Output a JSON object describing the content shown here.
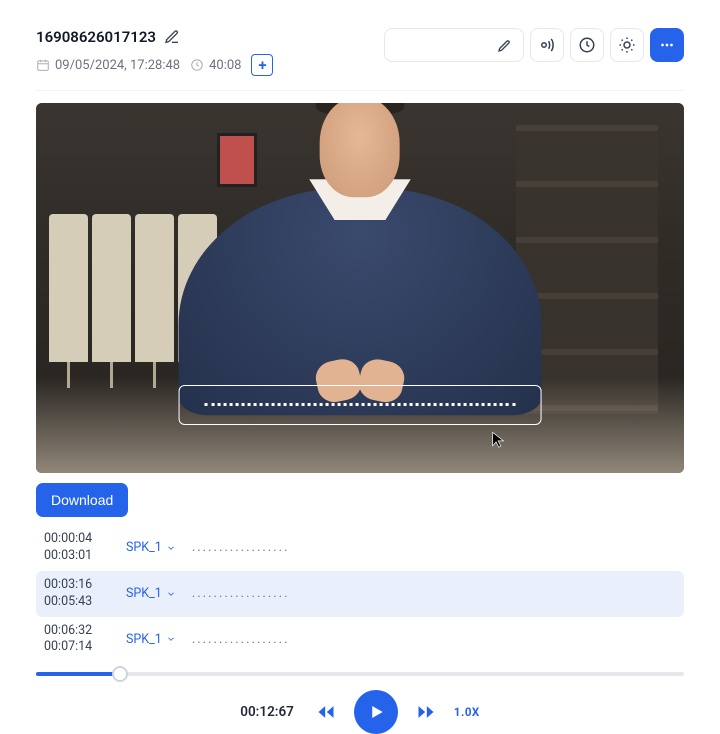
{
  "header": {
    "title": "16908626017123",
    "date": "09/05/2024, 17:28:48",
    "duration": "40:08"
  },
  "actions": {
    "download": "Download"
  },
  "transcript": [
    {
      "start": "00:00:04",
      "end": "00:03:01",
      "speaker": "SPK_1",
      "text": "..................",
      "active": false
    },
    {
      "start": "00:03:16",
      "end": "00:05:43",
      "speaker": "SPK_1",
      "text": "..................",
      "active": true
    },
    {
      "start": "00:06:32",
      "end": "00:07:14",
      "speaker": "SPK_1",
      "text": "..................",
      "active": false
    }
  ],
  "playback": {
    "current": "00:12:67",
    "rate": "1.0X",
    "progress_pct": 13
  }
}
